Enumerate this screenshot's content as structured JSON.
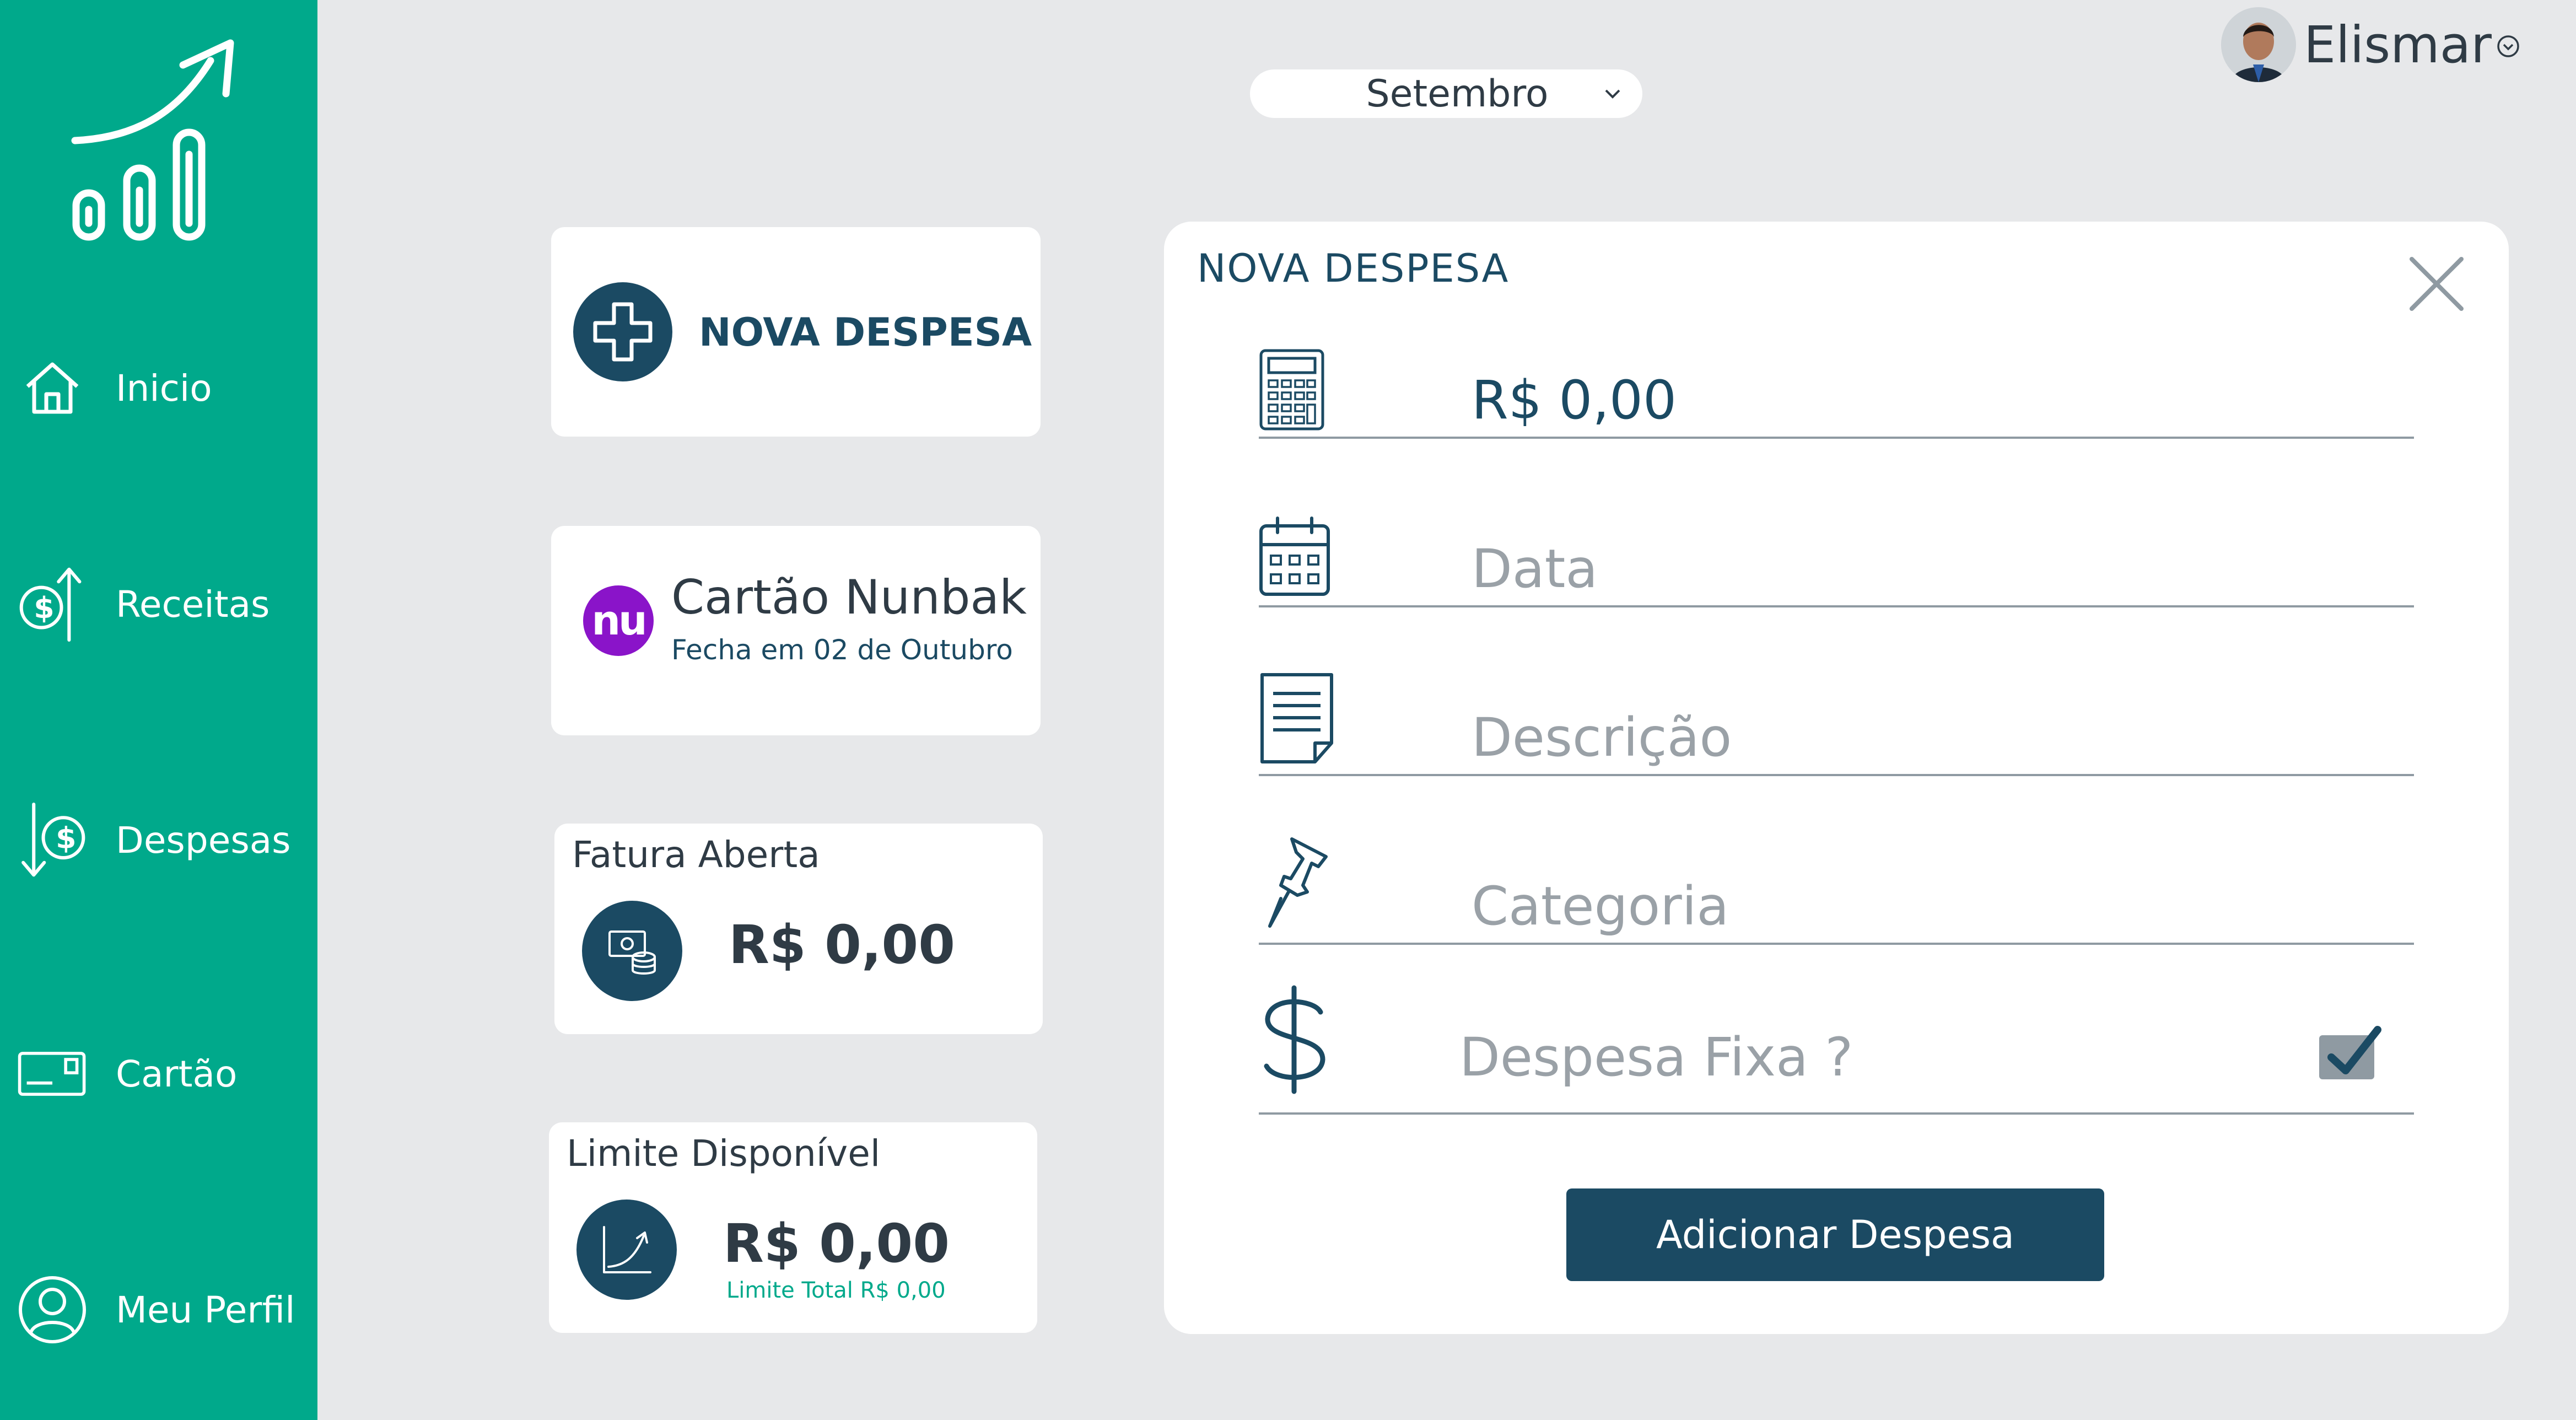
{
  "sidebar": {
    "items": [
      {
        "label": "Inicio",
        "icon": "home-icon"
      },
      {
        "label": "Receitas",
        "icon": "money-up-icon"
      },
      {
        "label": "Despesas",
        "icon": "money-down-icon"
      },
      {
        "label": "Cartão",
        "icon": "card-icon"
      },
      {
        "label": "Meu Perfil",
        "icon": "user-icon"
      }
    ]
  },
  "header": {
    "month": "Setembro",
    "user_name": "Elismar"
  },
  "cards": {
    "new_expense_label": "NOVA DESPESA",
    "nubank_title": "Cartão Nunbak",
    "nubank_subtitle": "Fecha em 02 de Outubro",
    "nubank_logo_text": "nu",
    "fatura_title": "Fatura Aberta",
    "fatura_value": "R$ 0,00",
    "limite_title": "Limite Disponível",
    "limite_value": "R$ 0,00",
    "limite_total": "Limite Total R$ 0,00"
  },
  "form": {
    "title": "NOVA DESPESA",
    "valor_value": "R$ 0,00",
    "data_placeholder": "Data",
    "descricao_placeholder": "Descrição",
    "categoria_placeholder": "Categoria",
    "fixed_label": "Despesa Fixa ?",
    "fixed_checked": true,
    "submit_label": "Adicionar Despesa"
  },
  "colors": {
    "sidebar": "#00a98b",
    "primary": "#1b4a63",
    "background": "#e7e8ea",
    "nubank": "#8a14c9"
  }
}
